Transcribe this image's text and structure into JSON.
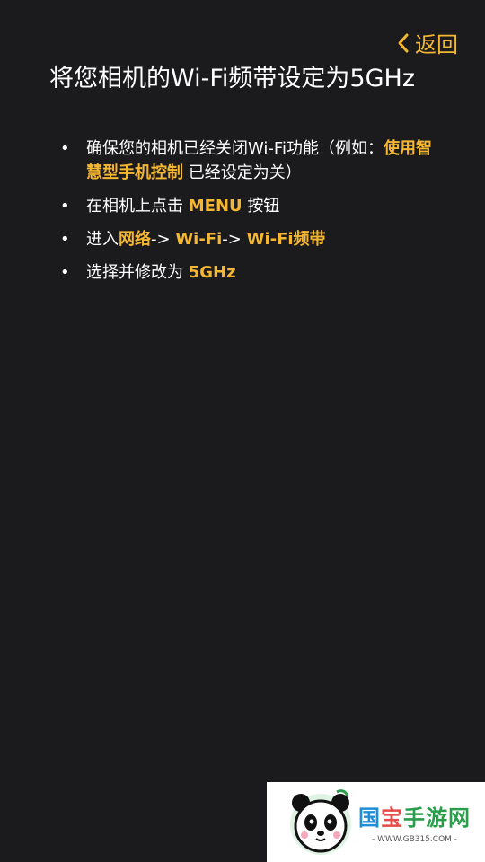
{
  "header": {
    "back_label": "返回"
  },
  "title": "将您相机的Wi-Fi频带设定为5GHz",
  "steps": [
    {
      "parts": [
        {
          "text": "确保您的相机已经关闭Wi-Fi功能（例如：",
          "highlight": false
        },
        {
          "text": "使用智慧型手机控制",
          "highlight": true
        },
        {
          "text": " 已经设定为关）",
          "highlight": false
        }
      ]
    },
    {
      "parts": [
        {
          "text": "在相机上点击 ",
          "highlight": false
        },
        {
          "text": "MENU",
          "highlight": true
        },
        {
          "text": " 按钮",
          "highlight": false
        }
      ]
    },
    {
      "parts": [
        {
          "text": "进入",
          "highlight": false
        },
        {
          "text": "网络",
          "highlight": true
        },
        {
          "text": "-> ",
          "highlight": false
        },
        {
          "text": "Wi-Fi",
          "highlight": true
        },
        {
          "text": "-> ",
          "highlight": false
        },
        {
          "text": "Wi-Fi频带",
          "highlight": true
        }
      ]
    },
    {
      "parts": [
        {
          "text": "选择并修改为 ",
          "highlight": false
        },
        {
          "text": "5GHz",
          "highlight": true
        }
      ]
    }
  ],
  "bullet": "•",
  "colors": {
    "background": "#1b1b1d",
    "accent": "#f5b731",
    "text": "#ffffff"
  },
  "watermark": {
    "title_1": "国",
    "title_2": "宝",
    "title_3": "手游网",
    "url": "- WWW.GB315.COM -",
    "icon": "panda-logo-icon"
  }
}
